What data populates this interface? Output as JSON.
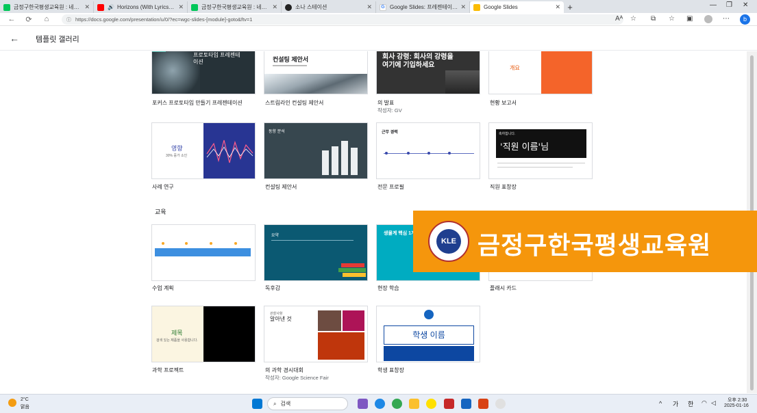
{
  "browser": {
    "tabs": [
      {
        "title": "금정구한국평생교육원 : 네이버",
        "color": "#03c75a"
      },
      {
        "title": "Horizons (With Lyrics) - Mu",
        "color": "#ff0000"
      },
      {
        "title": "금정구한국평생교육원 : 네이버",
        "color": "#03c75a"
      },
      {
        "title": "소나 스테이션",
        "color": "#222222"
      },
      {
        "title": "Google Slides: 프레젠테이션 슬",
        "color": "#4285f4"
      },
      {
        "title": "Google Slides",
        "color": "#fbbc04"
      }
    ],
    "url": "https://docs.google.com/presentation/u/0/?ec=wgc-slides-[module]-goto&ftv=1"
  },
  "header": {
    "title": "템플릿 갤러리"
  },
  "templates_row1": [
    {
      "label": "포커스 프로토타입 만들기 프레젠테이션",
      "thumb_text": "프로토타입 프레젠테이션"
    },
    {
      "label": "스트림라인 컨설팅 제안서",
      "thumb_text": "컨설팅 제안서"
    },
    {
      "label": "의 발표",
      "sub": "작성자: GV",
      "thumb_text": "회사 강령: 회사의 강령을 여기에 기입하세요"
    },
    {
      "label": "현황 보고서",
      "thumb_text": "개요"
    }
  ],
  "templates_row2": [
    {
      "label": "사례 연구",
      "thumb_text": "영향",
      "thumb_sub": "30% 증가 소인"
    },
    {
      "label": "컨설팅 제안서",
      "thumb_text": "동향 분석"
    },
    {
      "label": "전문 프로필",
      "thumb_text": "근무 경력"
    },
    {
      "label": "직원 표창장",
      "thumb_text": "'직원 이름'님",
      "thumb_top": "축하합니다."
    }
  ],
  "section_title": "교육",
  "templates_row3": [
    {
      "label": "수업 계획"
    },
    {
      "label": "독후감",
      "thumb_text": "요약"
    },
    {
      "label": "현장 학습",
      "thumb_text": "생물계 핵심 1개"
    },
    {
      "label": "플래시 카드"
    }
  ],
  "templates_row4": [
    {
      "label": "과학 프로젝트",
      "thumb_text": "제목",
      "thumb_sub": "검색 있는 제품을 사용합니다."
    },
    {
      "label": "의 과학 경시대회",
      "sub": "작성자: Google Science Fair",
      "thumb_text": "알아낸 것",
      "thumb_top": "관찰사항"
    },
    {
      "label": "학생 표창장",
      "thumb_text": "학생 이름"
    }
  ],
  "banner": {
    "text": "금정구한국평생교육원",
    "logo": "KLE"
  },
  "taskbar": {
    "weather_temp": "2°C",
    "weather_desc": "맑음",
    "search_placeholder": "검색",
    "ime1": "가",
    "ime2": "한",
    "time": "오후 2:30",
    "date": "2025-01-16"
  }
}
